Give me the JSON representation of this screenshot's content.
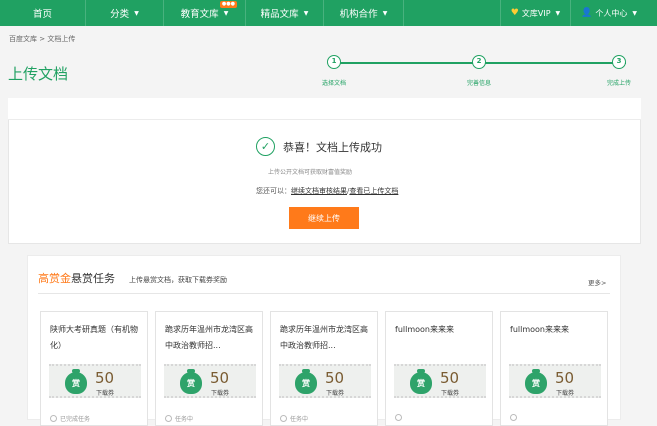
{
  "nav": {
    "items": [
      {
        "label": "首页",
        "caret": false,
        "hot": false
      },
      {
        "label": "分类",
        "caret": true,
        "hot": false
      },
      {
        "label": "教育文库",
        "caret": true,
        "hot": true
      },
      {
        "label": "精品文库",
        "caret": true,
        "hot": false
      },
      {
        "label": "机构合作",
        "caret": true,
        "hot": false
      }
    ],
    "vip": "文库VIP",
    "user": "个人中心"
  },
  "breadcrumb": "百度文库 > 文档上传",
  "page_title": "上传文档",
  "steps": [
    {
      "num": "1",
      "label": "选择文档"
    },
    {
      "num": "2",
      "label": "完善信息"
    },
    {
      "num": "3",
      "label": "完成上传"
    }
  ],
  "success": {
    "title": "恭喜！文档上传成功",
    "subtitle": "上传公开文档可获取财富值奖励",
    "also_prefix": "您还可以：",
    "link_review": "继续文档审核结果",
    "separator": "/",
    "link_uploaded": "查看已上传文档",
    "continue_label": "继续上传"
  },
  "reward": {
    "title_orange": "高赏金",
    "title_dark": "悬赏任务",
    "desc": "上传悬赏文档，获取下载券奖励",
    "more": "更多>",
    "tasks": [
      {
        "title": "陕师大考研真题（有机物化）",
        "amount": "50",
        "unit": "下载券",
        "foot": "已完成任务"
      },
      {
        "title": "跪求历年温州市龙湾区高中政治教师招...",
        "amount": "50",
        "unit": "下载券",
        "foot": "任务中"
      },
      {
        "title": "跪求历年温州市龙湾区高中政治教师招...",
        "amount": "50",
        "unit": "下载券",
        "foot": "任务中"
      },
      {
        "title": "fullmoon来来来",
        "amount": "50",
        "unit": "下载券",
        "foot": ""
      },
      {
        "title": "fullmoon来来来",
        "amount": "50",
        "unit": "下载券",
        "foot": ""
      }
    ]
  }
}
